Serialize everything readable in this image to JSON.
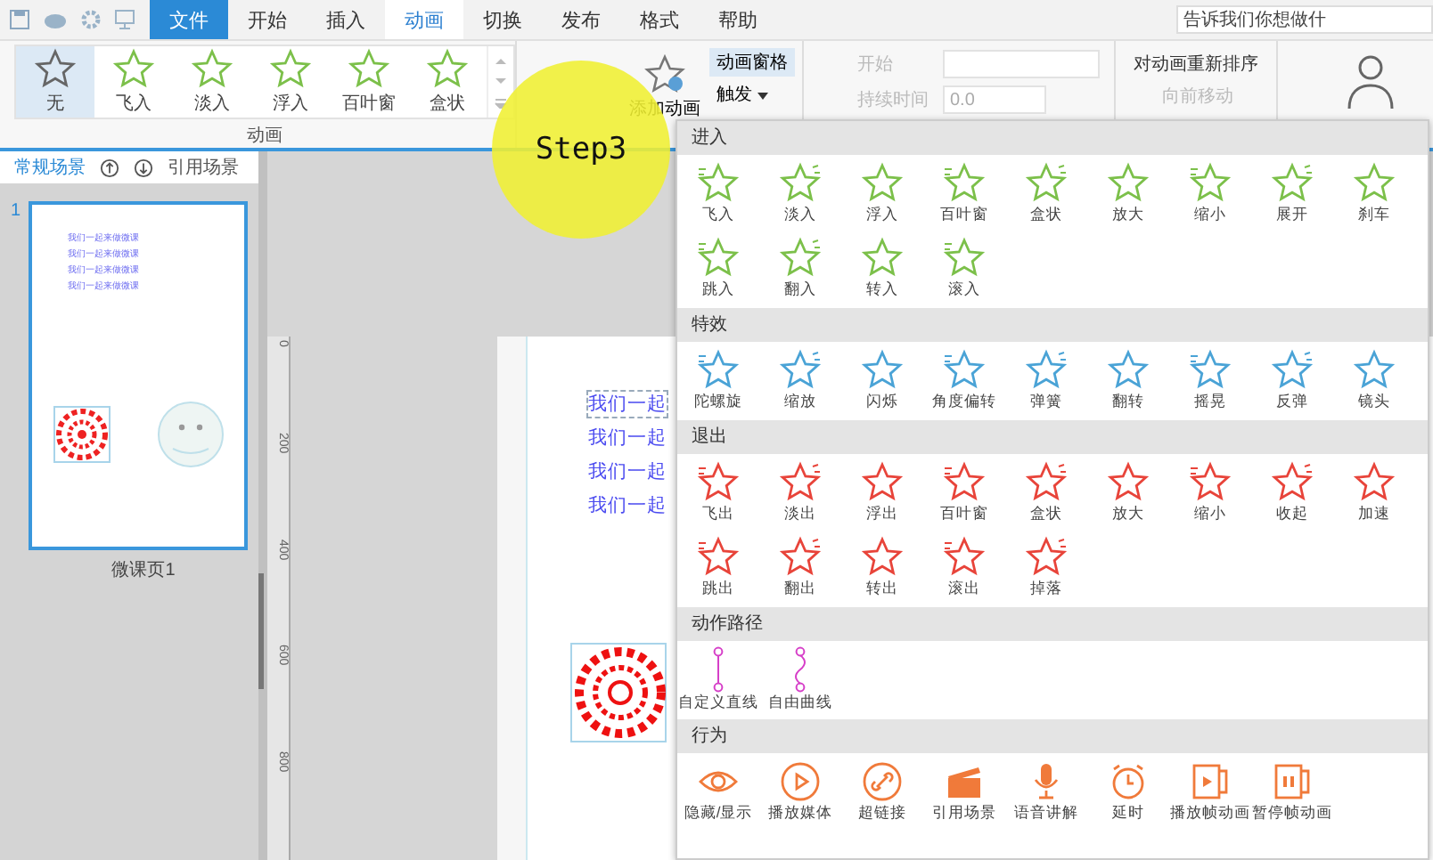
{
  "menu_bar": {
    "tabs": [
      {
        "label": "文件",
        "kind": "file",
        "selected": false
      },
      {
        "label": "开始",
        "kind": "tab",
        "selected": false
      },
      {
        "label": "插入",
        "kind": "tab",
        "selected": false
      },
      {
        "label": "动画",
        "kind": "tab",
        "selected": true
      },
      {
        "label": "切换",
        "kind": "tab",
        "selected": false
      },
      {
        "label": "发布",
        "kind": "tab",
        "selected": false
      },
      {
        "label": "格式",
        "kind": "tab",
        "selected": false
      },
      {
        "label": "帮助",
        "kind": "tab",
        "selected": false
      }
    ],
    "search": {
      "placeholder": "告诉我们你想做什"
    }
  },
  "ribbon": {
    "gallery": {
      "items": [
        {
          "label": "无",
          "selected": true
        },
        {
          "label": "飞入",
          "selected": false
        },
        {
          "label": "淡入",
          "selected": false
        },
        {
          "label": "浮入",
          "selected": false
        },
        {
          "label": "百叶窗",
          "selected": false
        },
        {
          "label": "盒状",
          "selected": false
        }
      ],
      "group_label": "动画"
    },
    "add_animation": "添加动画",
    "animation_pane": {
      "label": "动画窗格",
      "on": true
    },
    "trigger": "触发",
    "timing": [
      {
        "label": "开始",
        "kind": "select",
        "disabled": true
      },
      {
        "label": "持续时间",
        "kind": "number",
        "value": "0.0",
        "disabled": true
      }
    ],
    "reorder": {
      "title": "对动画重新排序",
      "items": [
        {
          "label": "向前移动",
          "disabled": true
        }
      ]
    }
  },
  "scene_panel": {
    "tabs": [
      {
        "label": "常规场景",
        "selected": true
      },
      {
        "label": "引用场景",
        "selected": false
      }
    ],
    "slides": [
      {
        "number": "1",
        "caption": "微课页1",
        "lines": [
          "我们一起来做微课",
          "我们一起来做微课",
          "我们一起来做微课",
          "我们一起来做微课"
        ]
      }
    ]
  },
  "canvas": {
    "ruler_ticks": [
      "0",
      "200",
      "400",
      "600",
      "800"
    ],
    "text_lines": [
      "我们一起",
      "我们一起",
      "我们一起",
      "我们一起"
    ]
  },
  "annotation": {
    "label": "Step3"
  },
  "animation_menu": {
    "sections": [
      {
        "title": "进入",
        "kind": "star",
        "color": "#7cc04a",
        "items": [
          "飞入",
          "淡入",
          "浮入",
          "百叶窗",
          "盒状",
          "放大",
          "缩小",
          "展开",
          "刹车",
          "跳入",
          "翻入",
          "转入",
          "滚入"
        ]
      },
      {
        "title": "特效",
        "kind": "star",
        "color": "#4aa3d6",
        "items": [
          "陀螺旋",
          "缩放",
          "闪烁",
          "角度偏转",
          "弹簧",
          "翻转",
          "摇晃",
          "反弹",
          "镜头"
        ]
      },
      {
        "title": "退出",
        "kind": "star",
        "color": "#e8443a",
        "items": [
          "飞出",
          "淡出",
          "浮出",
          "百叶窗",
          "盒状",
          "放大",
          "缩小",
          "收起",
          "加速",
          "跳出",
          "翻出",
          "转出",
          "滚出",
          "掉落"
        ]
      },
      {
        "title": "动作路径",
        "kind": "path",
        "color": "#d63fc8",
        "items": [
          "自定义直线",
          "自由曲线"
        ]
      },
      {
        "title": "行为",
        "kind": "action",
        "color": "#f07a3a",
        "items": [
          "隐藏/显示",
          "播放媒体",
          "超链接",
          "引用场景",
          "语音讲解",
          "延时",
          "播放帧动画",
          "暂停帧动画"
        ]
      }
    ]
  }
}
